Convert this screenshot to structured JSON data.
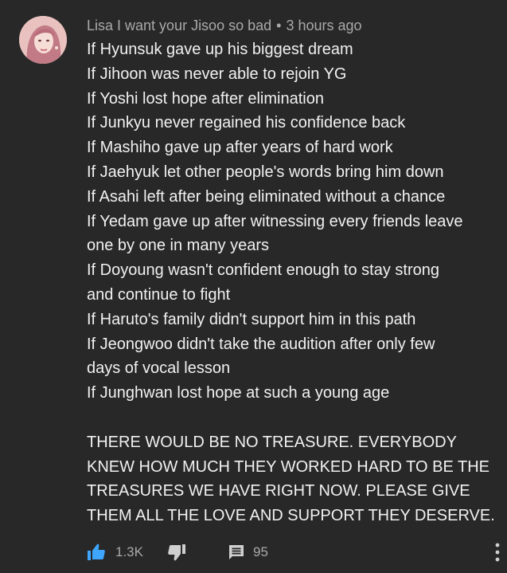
{
  "comment": {
    "author": "Lisa I want your Jisoo so bad",
    "separator": "•",
    "timestamp": "3 hours ago",
    "lines": [
      "If Hyunsuk gave up his biggest dream",
      "If Jihoon was never able to rejoin YG",
      "If Yoshi lost hope after elimination",
      "If Junkyu never regained his confidence back",
      "If Mashiho gave up after years of hard work",
      "If Jaehyuk let other people's words bring him down",
      "If Asahi left after being eliminated without a chance",
      "If Yedam gave up after witnessing every friends leave",
      "one by one in many years",
      "If Doyoung wasn't confident enough to stay strong",
      "and continue to fight",
      "If Haruto's family didn't support him in this path",
      "If Jeongwoo didn't take the audition after only few",
      "days of vocal lesson",
      "If Junghwan lost hope at such a young age"
    ],
    "closing_lines": [
      "THERE WOULD BE NO TREASURE. EVERYBODY",
      "KNEW HOW MUCH THEY WORKED HARD TO BE THE",
      "TREASURES WE HAVE RIGHT NOW. PLEASE GIVE",
      "THEM ALL THE LOVE AND SUPPORT THEY DESERVE."
    ],
    "like_count": "1.3K",
    "reply_count": "95"
  },
  "colors": {
    "background": "#282828",
    "text": "#f1f1f1",
    "meta": "#a9a9a9",
    "like_active": "#3ea6ff"
  },
  "icons": {
    "like": "thumbs-up-icon",
    "dislike": "thumbs-down-icon",
    "reply": "comment-icon",
    "more": "more-vertical-icon"
  }
}
